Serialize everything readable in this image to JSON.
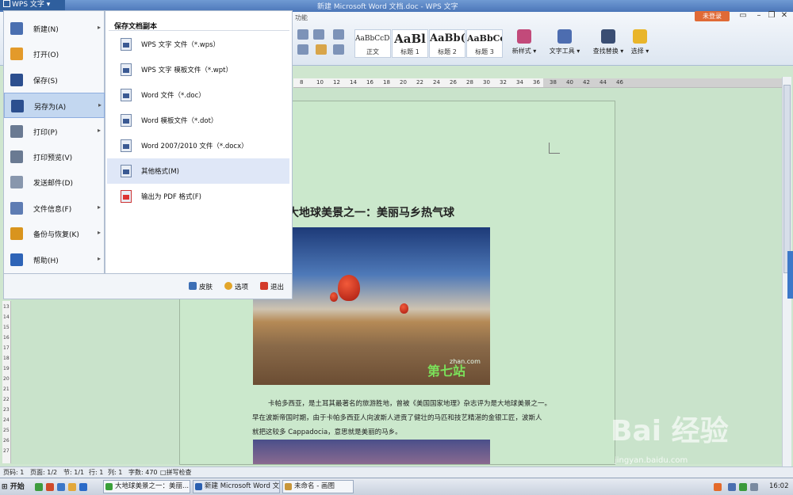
{
  "titlebar": {
    "app_button": "WPS 文字",
    "title": "新建 Microsoft Word 文档.doc - WPS 文字",
    "login": "未登录"
  },
  "ribbon": {
    "tab_label": "功能",
    "styles": [
      {
        "sample": "AaBbCcDd",
        "name": "正文"
      },
      {
        "sample": "AaBl",
        "name": "标题 1"
      },
      {
        "sample": "AaBb(",
        "name": "标题 2"
      },
      {
        "sample": "AaBbCcD",
        "name": "标题 3"
      }
    ],
    "buttons": {
      "new_style": "新样式",
      "text_tools": "文字工具",
      "find_replace": "查找替换",
      "select": "选择"
    }
  },
  "ruler": {
    "ticks": [
      "8",
      "10",
      "12",
      "14",
      "16",
      "18",
      "20",
      "22",
      "24",
      "26",
      "28",
      "30",
      "32",
      "34",
      "36",
      "38",
      "40",
      "42",
      "44",
      "46"
    ],
    "vticks": [
      "13",
      "14",
      "15",
      "16",
      "17",
      "18",
      "19",
      "20",
      "21",
      "22",
      "23",
      "24",
      "25",
      "26",
      "27"
    ]
  },
  "file_menu": {
    "items": [
      {
        "label": "新建(N)",
        "icon": "new-doc-icon",
        "arrow": true,
        "color": "#4a6fb0"
      },
      {
        "label": "打开(O)",
        "icon": "open-folder-icon",
        "arrow": false,
        "color": "#e39a2a"
      },
      {
        "label": "保存(S)",
        "icon": "save-disk-icon",
        "arrow": false,
        "color": "#2c4f8f"
      },
      {
        "label": "另存为(A)",
        "icon": "save-as-icon",
        "arrow": true,
        "color": "#2c4f8f",
        "active": true
      },
      {
        "label": "打印(P)",
        "icon": "printer-icon",
        "arrow": true,
        "color": "#6a7a92"
      },
      {
        "label": "打印预览(V)",
        "icon": "print-preview-icon",
        "arrow": false,
        "color": "#6a7a92"
      },
      {
        "label": "发送邮件(D)",
        "icon": "mail-icon",
        "arrow": false,
        "color": "#8897ad"
      },
      {
        "label": "文件信息(F)",
        "icon": "file-info-icon",
        "arrow": true,
        "color": "#5e7cb3"
      },
      {
        "label": "备份与恢复(K)",
        "icon": "backup-icon",
        "arrow": true,
        "color": "#d9941d"
      },
      {
        "label": "帮助(H)",
        "icon": "help-icon",
        "arrow": true,
        "color": "#2e64b7"
      }
    ],
    "saveas": {
      "title": "保存文档副本",
      "items": [
        {
          "label": "WPS 文字 文件（*.wps）",
          "icon": "wps-file-icon"
        },
        {
          "label": "WPS 文字 模板文件（*.wpt）",
          "icon": "wpt-file-icon"
        },
        {
          "label": "Word 文件（*.doc）",
          "icon": "doc-file-icon"
        },
        {
          "label": "Word 模板文件（*.dot）",
          "icon": "dot-file-icon"
        },
        {
          "label": "Word 2007/2010 文件（*.docx）",
          "icon": "docx-file-icon"
        },
        {
          "label": "其他格式(M)",
          "icon": "other-format-icon",
          "active": true
        },
        {
          "label": "输出为 PDF 格式(F)",
          "icon": "pdf-file-icon",
          "pdf": true
        }
      ]
    },
    "bottom": {
      "skin": "皮肤",
      "options": "选项",
      "exit": "退出"
    }
  },
  "document": {
    "title": "大地球美景之一：美丽马乡热气球",
    "watermark_logo": "第七站",
    "watermark_site": "zhan.com",
    "paragraph": [
      "卡帕多西亚，是土耳其最著名的旅游胜地，曾被《美国国家地理》杂志评为是大地球美景之一。",
      "早在波斯帝国时期，由于卡帕多西亚人向波斯人进贡了健壮的马匹和技艺精湛的金银工匠，波斯人",
      "就把这较多 Cappadocia，意思就是美丽的马乡。"
    ]
  },
  "statusbar": {
    "page_code": "页码: 1",
    "pages": "页面: 1/2",
    "section": "节: 1/1",
    "row": "行: 1",
    "col": "列: 1",
    "chars": "字数: 470",
    "spell": "拼写检查"
  },
  "taskbar": {
    "start": "开始",
    "tasks": [
      "大地球美景之一：美丽...",
      "新建 Microsoft Word 文...",
      "未命名 - 画图"
    ],
    "clock": "16:02"
  },
  "watermark": {
    "brand": "Bai 经验",
    "url": "jingyan.baidu.com"
  }
}
